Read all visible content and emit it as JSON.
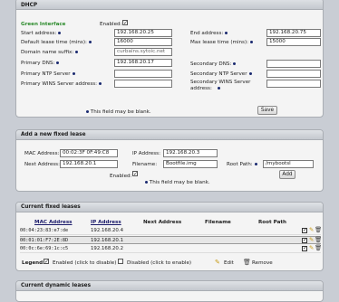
{
  "dhcp": {
    "title": "DHCP",
    "interface_label": "Green Interface",
    "enabled_label": "Enabled:",
    "enabled_checked": true,
    "start_label": "Start address:",
    "start_value": "192.168.20.25",
    "end_label": "End address:",
    "end_value": "192.168.20.75",
    "default_lease_label": "Default lease time (mins):",
    "default_lease_value": "16000",
    "max_lease_label": "Max lease time (mins):",
    "max_lease_value": "15000",
    "domain_label": "Domain name suffix:",
    "domain_value": "curbains.sytoic.net",
    "primary_dns_label": "Primary DNS:",
    "primary_dns_value": "192.168.20.17",
    "secondary_dns_label": "Secondary DNS:",
    "secondary_dns_value": "",
    "primary_ntp_label": "Primary NTP Server",
    "primary_ntp_value": "",
    "secondary_ntp_label": "Secondary NTP Server",
    "secondary_ntp_value": "",
    "primary_wins_label": "Primary WINS Server address:",
    "primary_wins_value": "",
    "secondary_wins_label": "Secondary WINS Server address:",
    "secondary_wins_value": "",
    "blank_note": "This field may be blank.",
    "save_label": "Save"
  },
  "fixed_lease_form": {
    "title": "Add a new fixed lease",
    "mac_label": "MAC Address:",
    "mac_value": "00:02:3F 0F:49:C8",
    "ip_label": "IP Address:",
    "ip_value": "192.168.20.3",
    "next_label": "Next Address:",
    "next_value": "192.168.20.1",
    "filename_label": "Filename:",
    "filename_value": "Bootfile.img",
    "root_label": "Root Path:",
    "root_value": "/mybootsl",
    "enabled_label": "Enabled:",
    "enabled_checked": true,
    "blank_note": "This field may be blank.",
    "add_label": "Add"
  },
  "current_fixed": {
    "title": "Current fixed leases",
    "columns": [
      "MAC Address",
      "IP Address",
      "Next Address",
      "Filename",
      "Root Path"
    ],
    "rows": [
      {
        "mac": "00:04:23:83:e7:de",
        "ip": "192.168.20.4",
        "next": "",
        "filename": "",
        "root": ""
      },
      {
        "mac": "00:01:01:F7:2E:8D",
        "ip": "192.168.20.1",
        "next": "",
        "filename": "",
        "root": ""
      },
      {
        "mac": "00:0c:6e:69:1c:c5",
        "ip": "192.168.20.2",
        "next": "",
        "filename": "",
        "root": ""
      }
    ],
    "legend_label": "Legend:",
    "legend_enabled": "Enabled (click to disable)",
    "legend_disabled": "Disabled (click to enable)",
    "legend_edit": "Edit",
    "legend_remove": "Remove"
  },
  "current_dynamic": {
    "title": "Current dynamic leases"
  },
  "icons": {
    "checkmark": "check-icon",
    "edit": "pencil-icon",
    "remove": "trash-icon",
    "required": "required-dot-icon"
  }
}
